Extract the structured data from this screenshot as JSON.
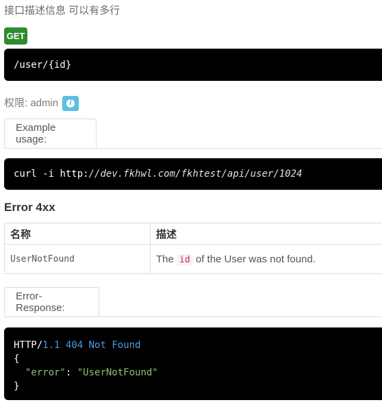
{
  "description": "接口描述信息 可以有多行",
  "method": "GET",
  "path": "/user/{id}",
  "permission": {
    "label": "权限:",
    "value": "admin",
    "icon": "info-icon",
    "icon_color": "#5bc0de"
  },
  "example": {
    "tab_label": "Example usage:",
    "command": "curl -i",
    "scheme": "http:",
    "url_rest": "//dev.fkhwl.com/fkhtest/api/user/1024"
  },
  "errors": {
    "heading": "Error 4xx",
    "columns": [
      "名称",
      "描述"
    ],
    "rows": [
      {
        "name": "UserNotFound",
        "desc_prefix": "The",
        "desc_code": "id",
        "desc_suffix": "of the User was not found."
      }
    ]
  },
  "error_response": {
    "tab_label": "Error-Response:",
    "http_prefix": "HTTP/",
    "http_version": "1.1",
    "status_code": "404",
    "status_text": "Not Found",
    "open_brace": "{",
    "json_key": "\"error\"",
    "json_colon": ": ",
    "json_value": "\"UserNotFound\"",
    "close_brace": "}"
  },
  "colors": {
    "method_badge": "#2e8b2e",
    "code_background": "#000000",
    "inline_code_text": "#c7254e"
  }
}
